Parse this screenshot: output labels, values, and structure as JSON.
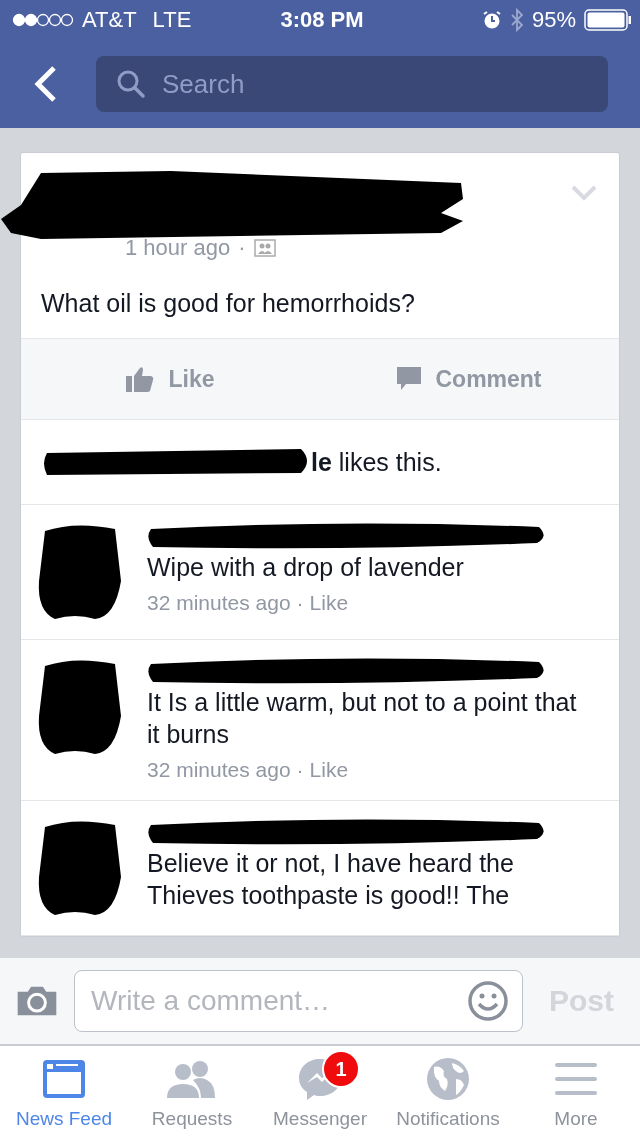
{
  "status_bar": {
    "carrier": "AT&T",
    "network": "LTE",
    "time": "3:08 PM",
    "battery": "95%"
  },
  "nav": {
    "search": {
      "placeholder": "Search"
    }
  },
  "post": {
    "time": "1 hour ago",
    "separator": "·",
    "text": "What oil is good for hemorrhoids?",
    "actions": [
      {
        "kind": "like",
        "label": "Like"
      },
      {
        "kind": "comment",
        "label": "Comment"
      }
    ],
    "likes": "**le** likes this."
  },
  "comments": [
    {
      "text": "Wipe with a drop of lavender",
      "time": "32 minutes ago",
      "separator": "·",
      "like": "Like"
    },
    {
      "text": "It Is a little warm, but not to a point that it burns",
      "time": "32 minutes ago",
      "separator": "·",
      "like": "Like"
    },
    {
      "text": "Believe it or not, I have heard the Thieves toothpaste is good!! The"
    }
  ],
  "composer": {
    "placeholder": "Write a comment…",
    "post": "Post",
    "disabled": true
  },
  "tabs": [
    {
      "kind": "feed",
      "label": "News Feed",
      "selected": true
    },
    {
      "kind": "requests",
      "label": "Requests",
      "selected": false
    },
    {
      "kind": "messenger",
      "label": "Messenger",
      "selected": false,
      "badge": "1"
    },
    {
      "kind": "globe",
      "label": "Notifications",
      "selected": false
    },
    {
      "kind": "more",
      "label": "More",
      "selected": false
    }
  ]
}
